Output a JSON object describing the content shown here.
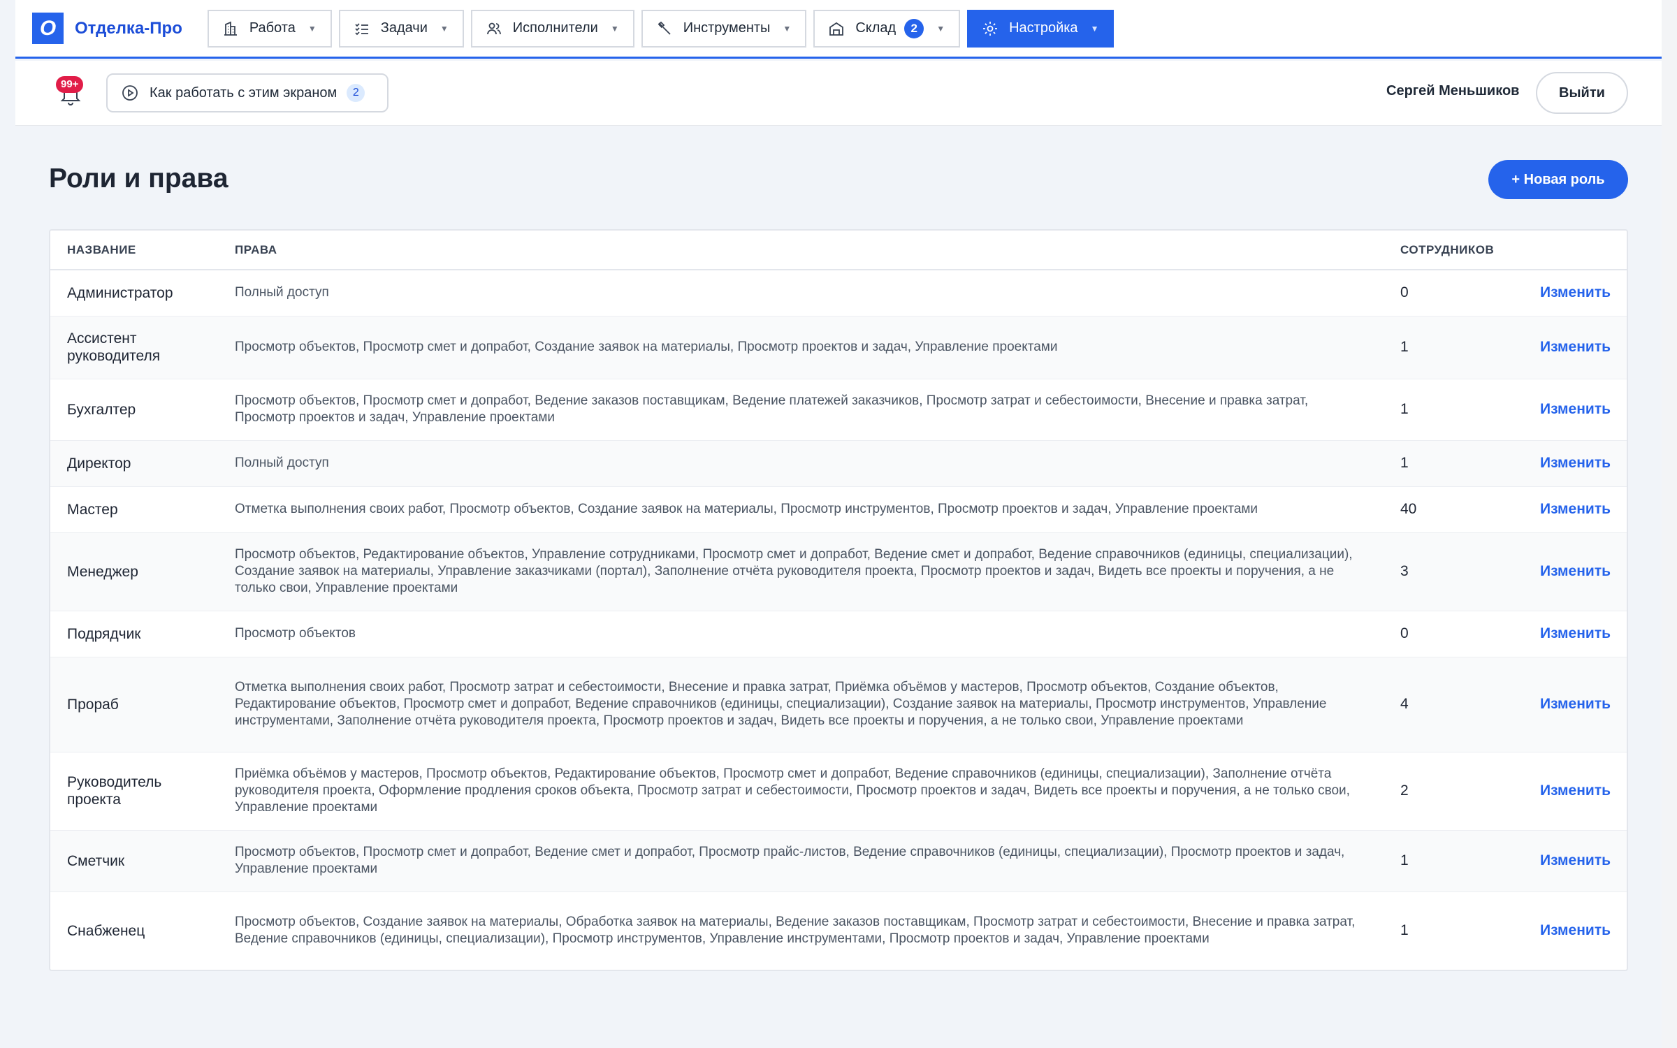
{
  "app": {
    "logo_letter": "О",
    "name": "Отделка-Про"
  },
  "nav": {
    "items": [
      {
        "label": "Работа"
      },
      {
        "label": "Задачи"
      },
      {
        "label": "Исполнители"
      },
      {
        "label": "Инструменты"
      },
      {
        "label": "Склад",
        "badge": "2"
      },
      {
        "label": "Настройка"
      }
    ],
    "active": "Настройка",
    "accent_color": "#2563eb"
  },
  "subbar": {
    "notifications_badge": "99+",
    "help_label": "Как работать с этим экраном",
    "help_count": "2",
    "user_name": "Сергей Меньшиков",
    "logout_label": "Выйти"
  },
  "page": {
    "title": "Роли и права",
    "new_role_label": "+ Новая роль"
  },
  "table": {
    "columns": [
      "Название",
      "Права",
      "Сотрудников",
      ""
    ],
    "edit_label": "Изменить",
    "rows": [
      {
        "name": "Администратор",
        "rights": "Полный доступ",
        "count": "0"
      },
      {
        "name": "Ассистент руководителя",
        "rights": "Просмотр объектов, Просмотр смет и допработ, Создание заявок на материалы, Просмотр проектов и задач, Управление проектами",
        "count": "1"
      },
      {
        "name": "Бухгалтер",
        "rights": "Просмотр объектов, Просмотр смет и допработ, Ведение заказов поставщикам, Ведение платежей заказчиков, Просмотр затрат и себестоимости, Внесение и правка затрат, Просмотр проектов и задач, Управление проектами",
        "count": "1"
      },
      {
        "name": "Директор",
        "rights": "Полный доступ",
        "count": "1"
      },
      {
        "name": "Мастер",
        "rights": "Отметка выполнения своих работ, Просмотр объектов, Создание заявок на материалы, Просмотр инструментов, Просмотр проектов и задач, Управление проектами",
        "count": "40"
      },
      {
        "name": "Менеджер",
        "rights": "Просмотр объектов, Редактирование объектов, Управление сотрудниками, Просмотр смет и допработ, Ведение смет и допработ, Ведение справочников (единицы, специализации), Создание заявок на материалы, Управление заказчиками (портал), Заполнение отчёта руководителя проекта, Просмотр проектов и задач, Видеть все проекты и поручения, а не только свои, Управление проектами",
        "count": "3"
      },
      {
        "name": "Подрядчик",
        "rights": "Просмотр объектов",
        "count": "0"
      },
      {
        "name": "Прораб",
        "rights": "Отметка выполнения своих работ, Просмотр затрат и себестоимости, Внесение и правка затрат, Приёмка объёмов у мастеров, Просмотр объектов, Создание объектов, Редактирование объектов, Просмотр смет и допработ, Ведение справочников (единицы, специализации), Создание заявок на материалы, Просмотр инструментов, Управление инструментами, Заполнение отчёта руководителя проекта, Просмотр проектов и задач, Видеть все проекты и поручения, а не только свои, Управление проектами",
        "count": "4"
      },
      {
        "name": "Руководитель проекта",
        "rights": "Приёмка объёмов у мастеров, Просмотр объектов, Редактирование объектов, Просмотр смет и допработ, Ведение справочников (единицы, специализации), Заполнение отчёта руководителя проекта, Оформление продления сроков объекта, Просмотр затрат и себестоимости, Просмотр проектов и задач, Видеть все проекты и поручения, а не только свои, Управление проектами",
        "count": "2"
      },
      {
        "name": "Сметчик",
        "rights": "Просмотр объектов, Просмотр смет и допработ, Ведение смет и допработ, Просмотр прайс-листов, Ведение справочников (единицы, специализации), Просмотр проектов и задач, Управление проектами",
        "count": "1"
      },
      {
        "name": "Снабженец",
        "rights": "Просмотр объектов, Создание заявок на материалы, Обработка заявок на материалы, Ведение заказов поставщикам, Просмотр затрат и себестоимости, Внесение и правка затрат, Ведение справочников (единицы, специализации), Просмотр инструментов, Управление инструментами, Просмотр проектов и задач, Управление проектами",
        "count": "1"
      }
    ]
  }
}
